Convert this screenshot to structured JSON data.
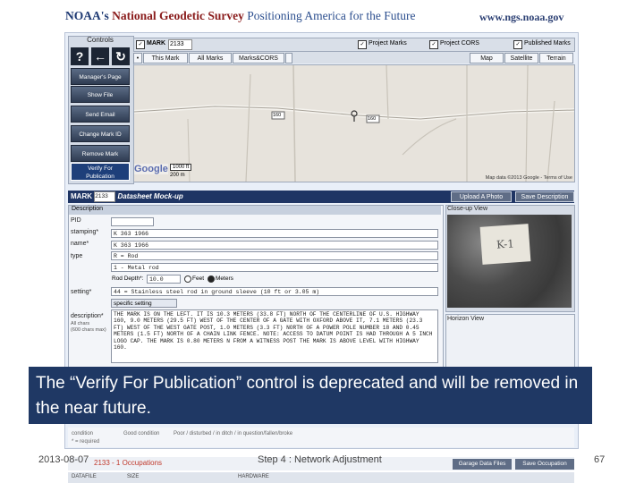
{
  "header": {
    "noaa": "NOAA's ",
    "ngs": "National Geodetic Survey",
    "tagline": " Positioning America for the Future",
    "url": "www.ngs.noaa.gov"
  },
  "controls": {
    "title": "Controls",
    "icons": [
      "?",
      "←",
      "↻"
    ],
    "buttons": [
      "Manager's Page",
      "Show File",
      "Send Email",
      "Change Mark ID",
      "Remove Mark"
    ],
    "selected_line1": "Verify For",
    "selected_line2": "Publication"
  },
  "map_toolbar": {
    "mark_label": "MARK",
    "mark_value": "2133",
    "project_marks": "Project Marks",
    "project_cors": "Project CORS",
    "published_marks": "Published Marks",
    "tabs_left": [
      "This Mark",
      "All Marks",
      "Marks&CORS"
    ],
    "tabs_right": [
      "Map",
      "Satellite",
      "Terrain"
    ]
  },
  "map": {
    "google": "Google",
    "scale_ft": "1000 ft",
    "scale_m": "200 m",
    "footer": "Map data ©2013 Google - Terms of Use",
    "route1": "160",
    "route2": "160"
  },
  "datasheet": {
    "mark_label": "MARK",
    "mark_value": "2133",
    "title": "Datasheet Mock-up",
    "upload_photo": "Upload A Photo",
    "save_description": "Save Description",
    "section": "Description",
    "labels": {
      "pid": "PID",
      "stamping": "stamping*",
      "name": "name*",
      "type": "type",
      "setting": "setting*",
      "description": "description*",
      "desc_note1": "All chars",
      "desc_note2": "(600 chars max)"
    },
    "values": {
      "pid": "",
      "stamping": "K 363 1966",
      "name": "K 363 1966",
      "type": "R = Rod",
      "subtype": "1 - Metal rod",
      "rod_depth_label": "Rod Depth*:",
      "rod_depth": "10.0",
      "feet": "Feet",
      "meters": "Meters",
      "setting": "44 = Stainless steel rod in ground sleeve (10 ft or 3.05 m)",
      "specific_setting": "specific setting",
      "description": "THE MARK IS ON THE LEFT. IT IS 10.3 METERS (33.8 FT) NORTH OF THE CENTERLINE OF U.S. HIGHWAY 160, 9.0 METERS (29.5 FT) WEST OF THE CENTER OF A GATE WITH OXFORD ABOVE IT, 7.1 METERS (23.3 FT) WEST OF THE WEST GATE POST, 1.0 METERS (3.3 FT) NORTH OF A POWER POLE NUMBER 18 AND 0.45 METERS (1.5 FT) NORTH OF A CHAIN LINK FENCE. NOTE: ACCESS TO DATUM POINT IS HAD THROUGH A 5 INCH LOGO CAP. THE MARK IS 0.80 METERS N FROM A WITNESS POST THE MARK IS ABOVE LEVEL WITH HIGHWAY 160."
    },
    "closeup_title": "Close-up View",
    "card_text": "K-1",
    "horizon_title": "Horizon View"
  },
  "below": {
    "line1": "condition",
    "line1_b": "Good condition",
    "line1_c": "Poor / disturbed / in ditch / in question/fallen/broke",
    "line2": "* = required"
  },
  "caption": {
    "text": "The “Verify For Publication” control is deprecated and will be removed in the near future."
  },
  "footer": {
    "date": "2013-08-07",
    "center": "Step 4 : Network Adjustment",
    "page": "67",
    "occupations": "2133 - 1 Occupations",
    "btn1": "Garage Data Files",
    "btn2": "Save Occupation",
    "strip_a": "DATAFILE",
    "strip_b": "SIZE",
    "strip_c": "HARDWARE"
  }
}
